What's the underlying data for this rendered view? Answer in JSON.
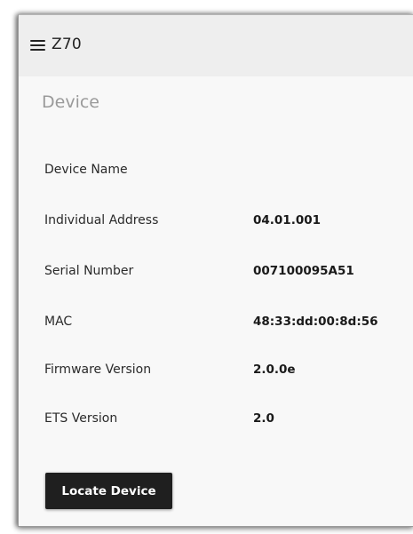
{
  "header": {
    "menu_icon": "hamburger-menu-icon",
    "title": "Z70"
  },
  "section": {
    "title": "Device"
  },
  "rows": [
    {
      "label": "Device Name",
      "value": ""
    },
    {
      "label": "Individual Address",
      "value": "04.01.001"
    },
    {
      "label": "Serial Number",
      "value": "007100095A51"
    },
    {
      "label": "MAC",
      "value": "48:33:dd:00:8d:56"
    },
    {
      "label": "Firmware Version",
      "value": "2.0.0e"
    },
    {
      "label": "ETS Version",
      "value": "2.0"
    }
  ],
  "actions": {
    "locate_label": "Locate Device"
  },
  "colors": {
    "button_bg": "#1f1f1f",
    "button_text": "#ffffff",
    "section_title": "#9a9a9a",
    "header_bg": "#eeeeee",
    "content_bg": "#f8f8f8"
  }
}
